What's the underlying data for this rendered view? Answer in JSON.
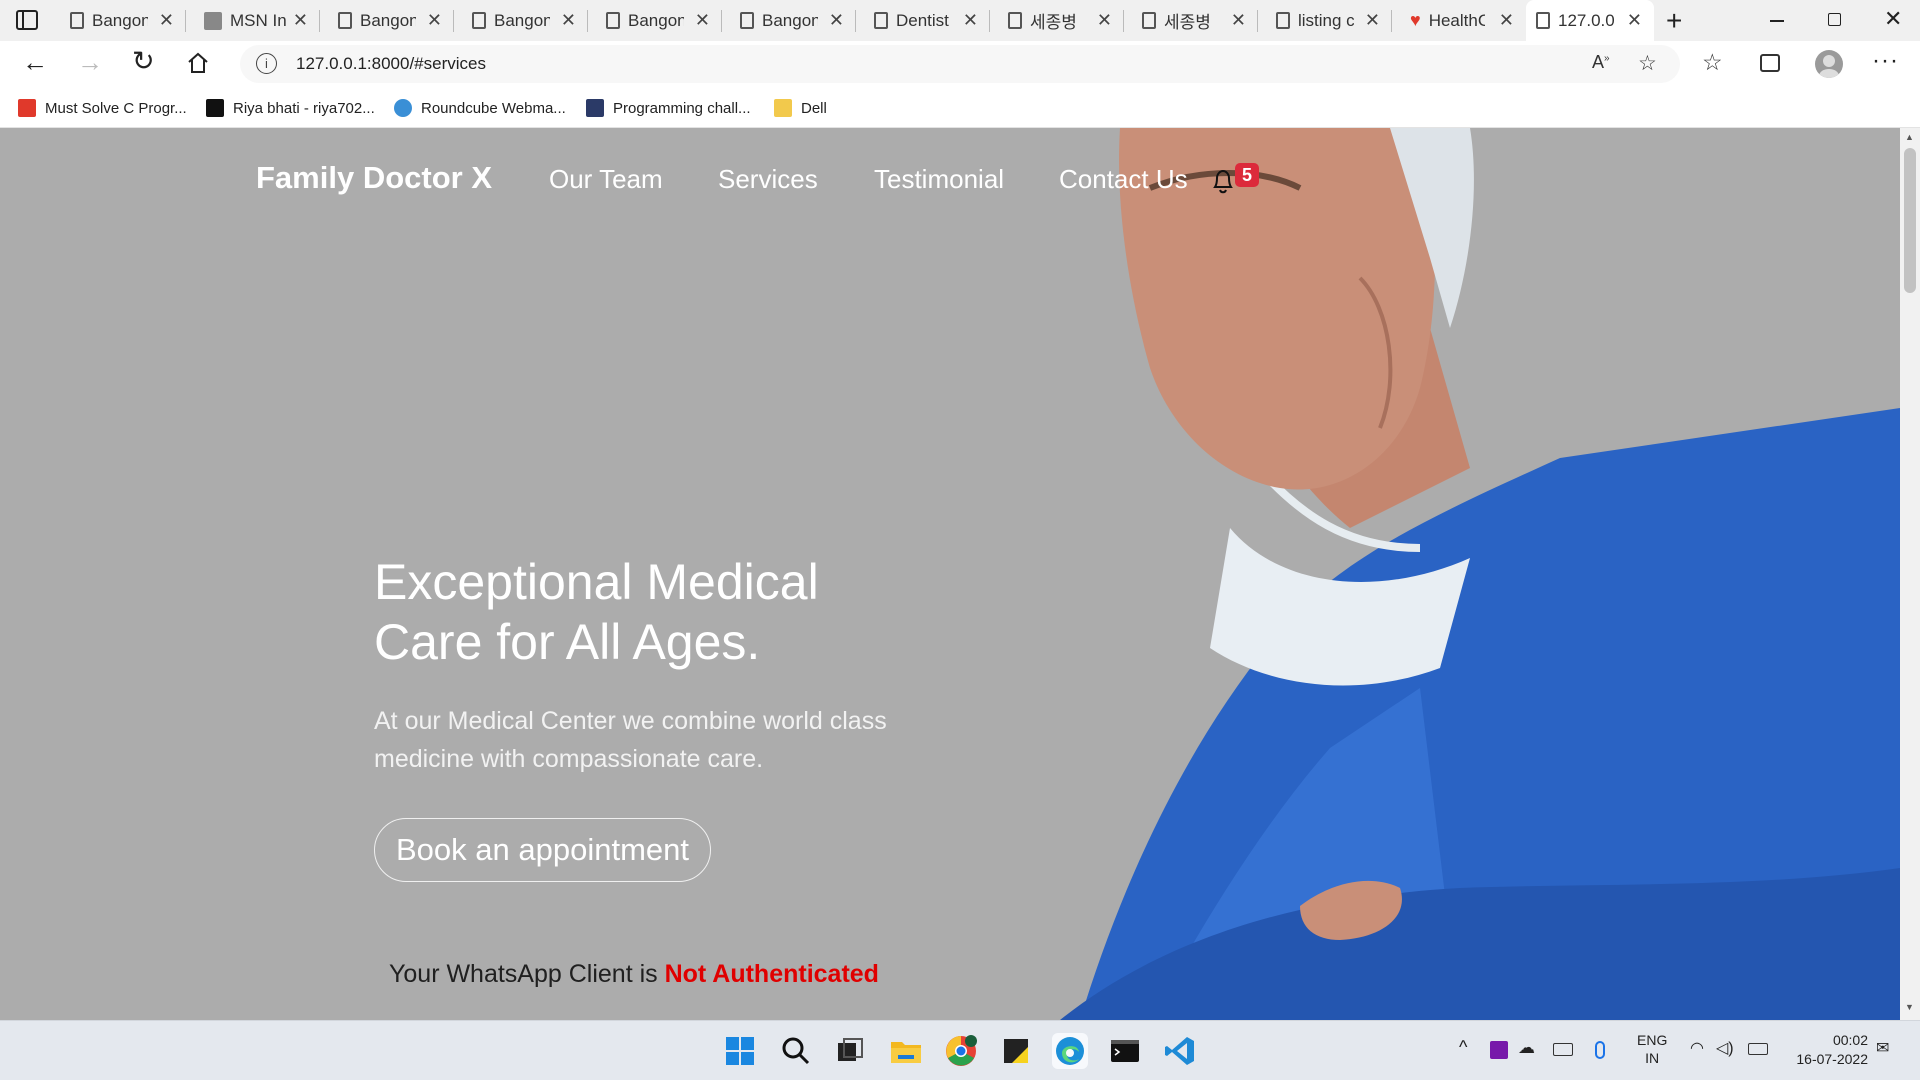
{
  "browser": {
    "tabs": [
      {
        "title": "Bangon",
        "icon": "page-icon"
      },
      {
        "title": "MSN In",
        "icon": "msn-icon"
      },
      {
        "title": "Bangon",
        "icon": "page-icon"
      },
      {
        "title": "Bangon",
        "icon": "page-icon"
      },
      {
        "title": "Bangon",
        "icon": "page-icon"
      },
      {
        "title": "Bangon",
        "icon": "page-icon"
      },
      {
        "title": "Dentist",
        "icon": "page-icon"
      },
      {
        "title": "세종병",
        "icon": "page-icon"
      },
      {
        "title": "세종병",
        "icon": "page-icon"
      },
      {
        "title": "listing c",
        "icon": "page-icon"
      },
      {
        "title": "HealthC",
        "icon": "heart-icon"
      },
      {
        "title": "127.0.0.",
        "icon": "page-icon",
        "active": true
      }
    ],
    "url": "127.0.0.1:8000/#services",
    "bookmarks": [
      {
        "label": "Must Solve C Progr...",
        "color": "#e0392b"
      },
      {
        "label": "Riya bhati - riya702...",
        "color": "#111111"
      },
      {
        "label": "Roundcube Webma...",
        "color": "#3a8fd6"
      },
      {
        "label": "Programming chall...",
        "color": "#2b3a67"
      },
      {
        "label": "Dell",
        "color": "#f2c94c"
      }
    ]
  },
  "site": {
    "brand": "Family Doctor X",
    "nav": [
      "Our Team",
      "Services",
      "Testimonial",
      "Contact Us"
    ],
    "notification_count": "5",
    "hero_title": "Exceptional Medical Care for All Ages.",
    "hero_subtitle": "At our Medical Center we combine world class medicine with compassionate care.",
    "cta": "Book an appointment",
    "whatsapp_prefix": "Your WhatsApp Client is",
    "whatsapp_status": "Not Authenticated"
  },
  "taskbar": {
    "lang_top": "ENG",
    "lang_bottom": "IN",
    "time": "00:02",
    "date": "16-07-2022"
  },
  "colors": {
    "hero_bg": "#acacac",
    "badge": "#dc2a3b",
    "status_red": "#e00000",
    "scrubs_blue": "#2a63c4"
  }
}
